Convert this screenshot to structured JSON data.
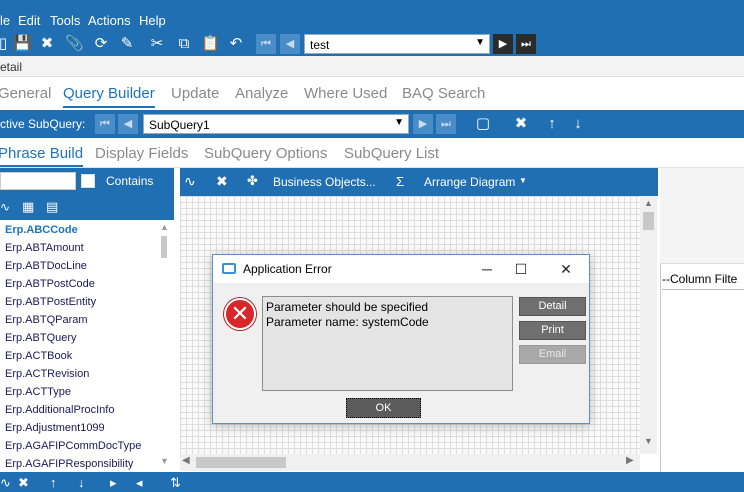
{
  "menu": [
    "le",
    "Edit",
    "Tools",
    "Actions",
    "Help"
  ],
  "toolbar": {
    "nav_value": "test"
  },
  "detail_label": "etail",
  "main_tabs": [
    {
      "label": "General"
    },
    {
      "label": "Query Builder"
    },
    {
      "label": "Update"
    },
    {
      "label": "Analyze"
    },
    {
      "label": "Where Used"
    },
    {
      "label": "BAQ Search"
    }
  ],
  "subquery": {
    "label": "ctive SubQuery:",
    "value": "SubQuery1"
  },
  "sub_tabs": [
    {
      "label": "Phrase Build"
    },
    {
      "label": "Display Fields"
    },
    {
      "label": "SubQuery Options"
    },
    {
      "label": "SubQuery List"
    }
  ],
  "left_panel": {
    "contains_label": "Contains",
    "tables": [
      "Erp.ABCCode",
      "Erp.ABTAmount",
      "Erp.ABTDocLine",
      "Erp.ABTPostCode",
      "Erp.ABTPostEntity",
      "Erp.ABTQParam",
      "Erp.ABTQuery",
      "Erp.ACTBook",
      "Erp.ACTRevision",
      "Erp.ACTType",
      "Erp.AdditionalProcInfo",
      "Erp.Adjustment1099",
      "Erp.AGAFIPCommDocType",
      "Erp.AGAFIPResponsibility"
    ]
  },
  "diagram_toolbar": {
    "business_objects": "Business Objects...",
    "arrange": "Arrange Diagram"
  },
  "right_panel": {
    "column_filter": "--Column Filte"
  },
  "dialog": {
    "title": "Application Error",
    "message_line1": "Parameter should be specified",
    "message_line2": "Parameter name: systemCode",
    "detail_button": "Detail",
    "print_button": "Print",
    "email_button": "Email",
    "ok_button": "OK"
  },
  "colors": {
    "brand": "#1f6fb2",
    "accent": "#1e73be",
    "error": "#d8262b"
  }
}
